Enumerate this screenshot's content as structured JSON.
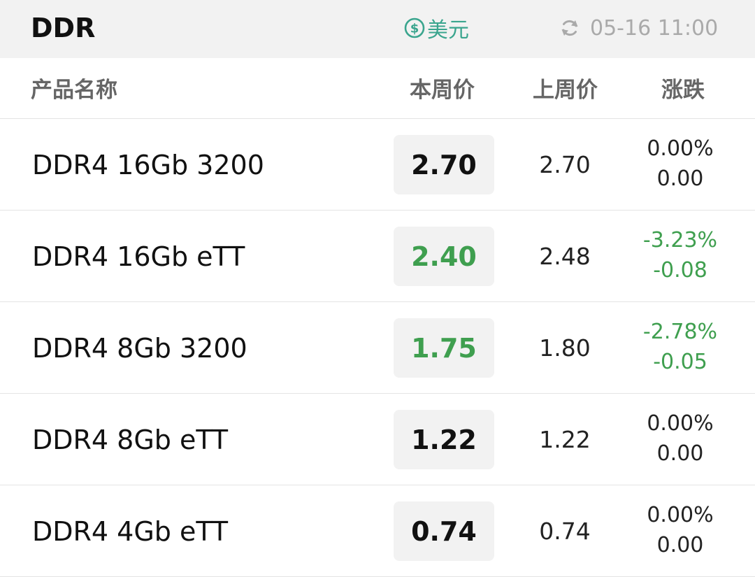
{
  "header": {
    "title": "DDR",
    "currency_label": "美元",
    "updated_time": "05-16 11:00"
  },
  "columns": {
    "name": "产品名称",
    "current": "本周价",
    "previous": "上周价",
    "change": "涨跌"
  },
  "rows": [
    {
      "name": "DDR4 16Gb 3200",
      "current": "2.70",
      "previous": "2.70",
      "change_pct": "0.00%",
      "change_abs": "0.00",
      "trend": "flat"
    },
    {
      "name": "DDR4 16Gb eTT",
      "current": "2.40",
      "previous": "2.48",
      "change_pct": "-3.23%",
      "change_abs": "-0.08",
      "trend": "down"
    },
    {
      "name": "DDR4 8Gb 3200",
      "current": "1.75",
      "previous": "1.80",
      "change_pct": "-2.78%",
      "change_abs": "-0.05",
      "trend": "down"
    },
    {
      "name": "DDR4 8Gb eTT",
      "current": "1.22",
      "previous": "1.22",
      "change_pct": "0.00%",
      "change_abs": "0.00",
      "trend": "flat"
    },
    {
      "name": "DDR4 4Gb eTT",
      "current": "0.74",
      "previous": "0.74",
      "change_pct": "0.00%",
      "change_abs": "0.00",
      "trend": "flat"
    }
  ],
  "colors": {
    "down": "#3f9f4f",
    "flat": "#111111",
    "accent": "#3aa58e",
    "muted": "#aaaaaa"
  },
  "icons": {
    "currency": "dollar-coin-icon",
    "refresh": "refresh-icon"
  }
}
